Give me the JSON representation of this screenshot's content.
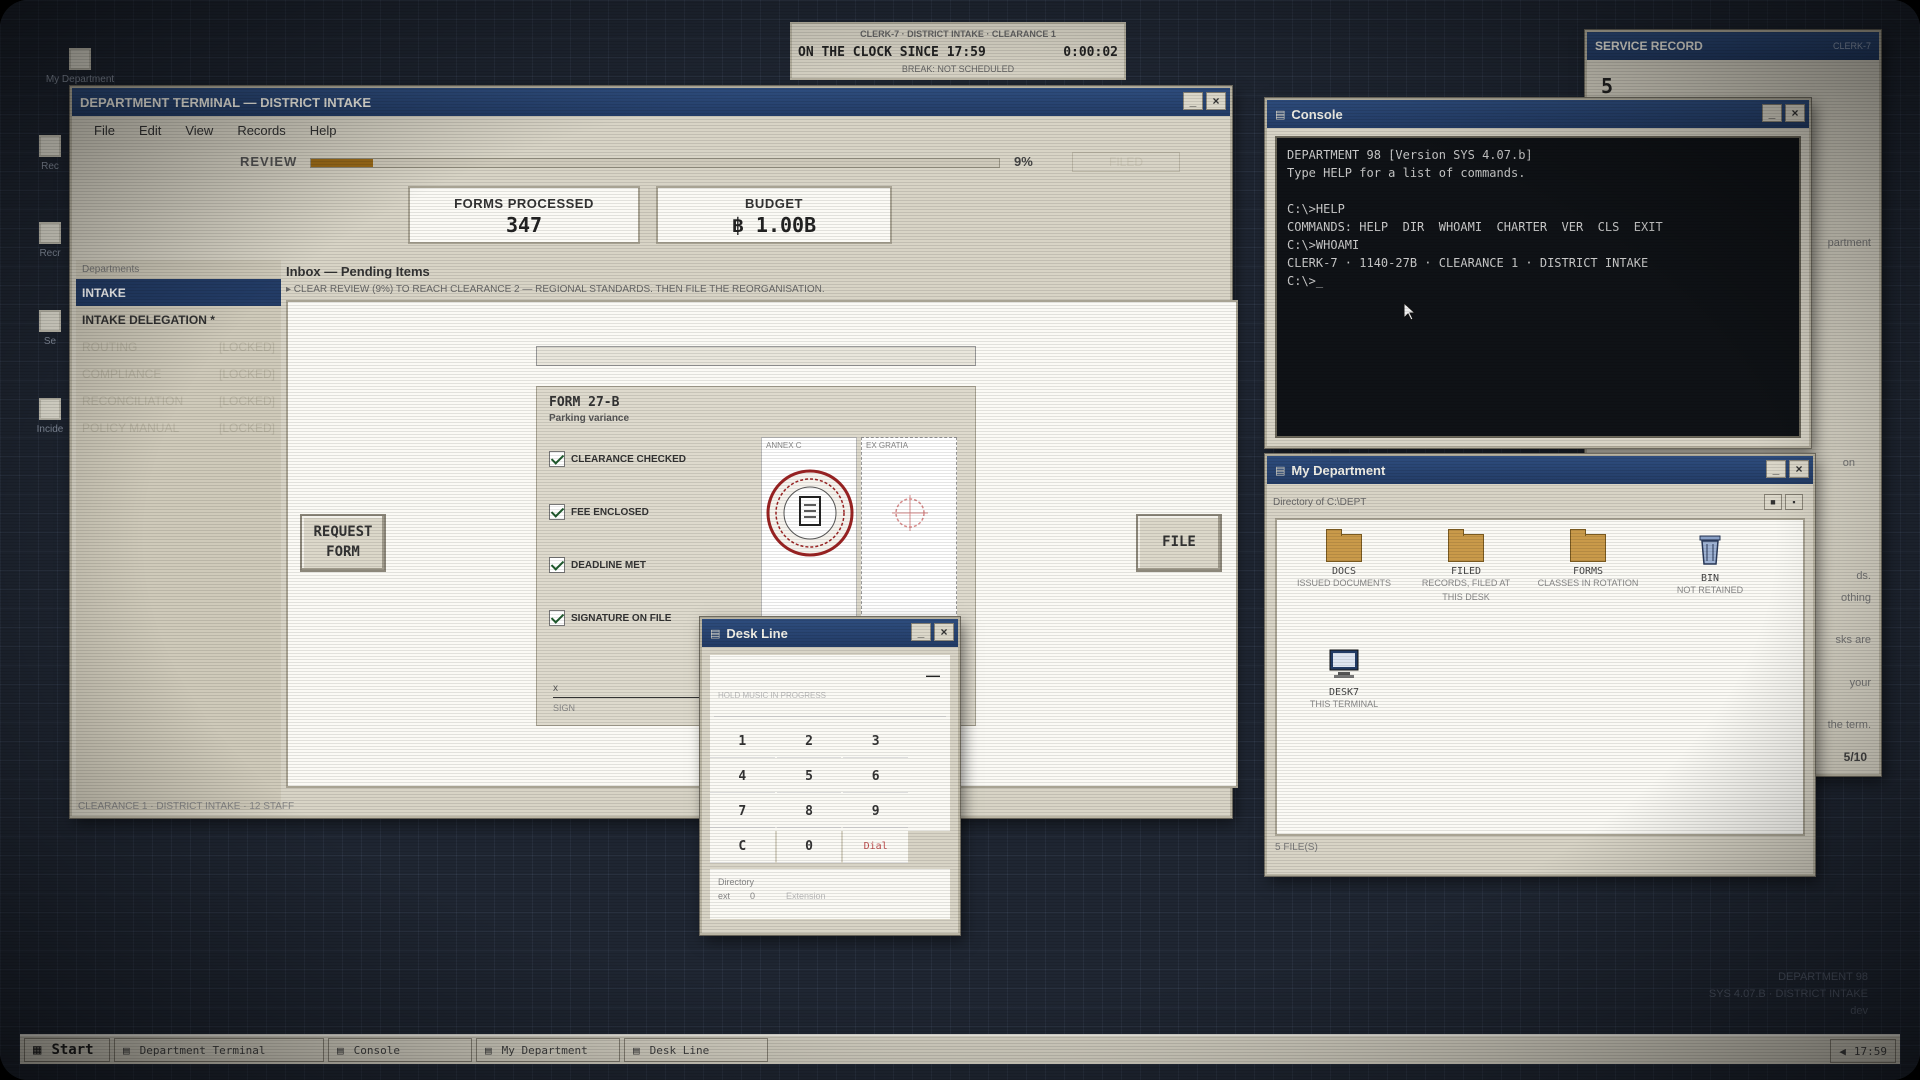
{
  "desktop": {
    "icons": [
      {
        "label": "My Department"
      },
      {
        "label": "Rec"
      },
      {
        "label": "Recr"
      },
      {
        "label": "Se"
      },
      {
        "label": "Incide"
      }
    ],
    "watermark": {
      "line1": "DEPARTMENT 98",
      "line2": "SYS 4.07.B · DISTRICT INTAKE",
      "line3": "dev"
    }
  },
  "clock": {
    "header": "CLERK-7 · DISTRICT INTAKE · CLEARANCE 1",
    "on_clock": "ON THE CLOCK SINCE 17:59",
    "elapsed": "0:00:02",
    "break": "BREAK: NOT SCHEDULED"
  },
  "service_record": {
    "title": "SERVICE RECORD",
    "clerk": "CLERK-7",
    "value": "5",
    "fragments": [
      "partment",
      "on",
      "ds.",
      "othing",
      "sks are",
      "your",
      "the term."
    ],
    "score": "5/10"
  },
  "terminal": {
    "title": "DEPARTMENT TERMINAL — DISTRICT INTAKE",
    "menu": [
      "File",
      "Edit",
      "View",
      "Records",
      "Help"
    ],
    "review": {
      "label": "REVIEW",
      "percent": 9,
      "percent_text": "9%",
      "filed_button": "FILED"
    },
    "stats": [
      {
        "label": "FORMS PROCESSED",
        "value": "347"
      },
      {
        "label": "BUDGET",
        "value": "฿ 1.00B"
      }
    ],
    "sidebar": {
      "heading": "Departments",
      "items": [
        {
          "label": "INTAKE",
          "tag": ""
        },
        {
          "label": "INTAKE DELEGATION *",
          "tag": ""
        },
        {
          "label": "ROUTING",
          "tag": "[LOCKED]"
        },
        {
          "label": "COMPLIANCE",
          "tag": "[LOCKED]"
        },
        {
          "label": "RECONCILIATION",
          "tag": "[LOCKED]"
        },
        {
          "label": "POLICY MANUAL",
          "tag": "[LOCKED]"
        }
      ]
    },
    "inbox_title": "Inbox — Pending Items",
    "inbox_hint": "▸ CLEAR REVIEW (9%) TO REACH CLEARANCE 2 — REGIONAL STANDARDS. THEN FILE THE REORGANISATION.",
    "request_button": "REQUEST FORM",
    "file_button": "FILE",
    "status": "CLEARANCE 1 · DISTRICT INTAKE · 12 STAFF",
    "form": {
      "title": "FORM 27-B",
      "subtitle": "Parking variance",
      "checks": [
        "CLEARANCE CHECKED",
        "FEE ENCLOSED",
        "DEADLINE MET",
        "SIGNATURE ON FILE"
      ],
      "annex_c": "ANNEX C",
      "ex_gratia": "EX GRATIA",
      "sign_mark": "x",
      "sign_label": "SIGN"
    }
  },
  "console": {
    "title": "Console",
    "lines": [
      "DEPARTMENT 98 [Version SYS 4.07.b]",
      "Type HELP for a list of commands.",
      "",
      "C:\\>HELP",
      "COMMANDS: HELP  DIR  WHOAMI  CHARTER  VER  CLS  EXIT",
      "C:\\>WHOAMI",
      "CLERK-7 · 1140-27B · CLEARANCE 1 · DISTRICT INTAKE",
      "C:\\>_"
    ]
  },
  "my_department": {
    "title": "My Department",
    "directory": "Directory of C:\\DEPT",
    "files": [
      {
        "name": "DOCS",
        "desc": "ISSUED DOCUMENTS",
        "icon": "folder-icon"
      },
      {
        "name": "FILED",
        "desc": "RECORDS, FILED AT THIS DESK",
        "icon": "folder-icon"
      },
      {
        "name": "FORMS",
        "desc": "CLASSES IN ROTATION",
        "icon": "folder-icon"
      },
      {
        "name": "BIN",
        "desc": "NOT RETAINED",
        "icon": "trash-icon"
      },
      {
        "name": "DESK7",
        "desc": "THIS TERMINAL",
        "icon": "computer-icon"
      }
    ],
    "status": "5 FILE(S)"
  },
  "desk_line": {
    "title": "Desk Line",
    "display_dash": "—",
    "display_hint": "HOLD MUSIC IN PROGRESS",
    "keys": [
      "1",
      "2",
      "3",
      "4",
      "5",
      "6",
      "7",
      "8",
      "9",
      "C",
      "0",
      "Dial"
    ],
    "directory_label": "Directory",
    "directory_ext": "ext",
    "directory_ext_value": "0",
    "directory_entry": "Extension"
  },
  "taskbar": {
    "start": "Start",
    "tasks": [
      "Department Terminal",
      "Console",
      "My Department",
      "Desk Line"
    ],
    "time": "17:59"
  }
}
